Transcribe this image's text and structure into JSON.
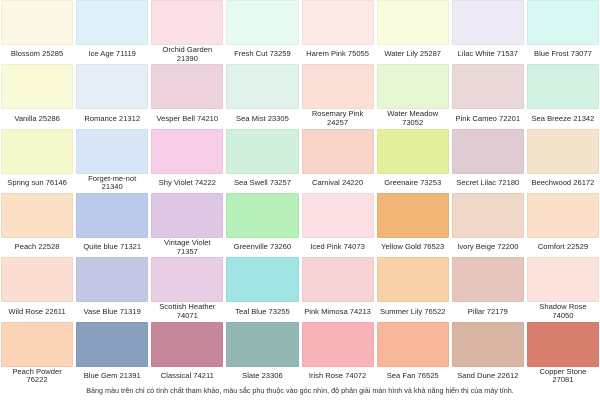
{
  "swatches": [
    {
      "name": "Blossom 25285",
      "color": "#fdf7e6"
    },
    {
      "name": "Ice Age 71119",
      "color": "#dff0f8"
    },
    {
      "name": "Orchid Garden\n21390",
      "color": "#fbe0e5"
    },
    {
      "name": "Fresh Cut 73259",
      "color": "#e8fbf0"
    },
    {
      "name": "Harem Pink 75055",
      "color": "#fde9e5"
    },
    {
      "name": "Water Lily 25287",
      "color": "#fbfbe0"
    },
    {
      "name": "Lilac White 71537",
      "color": "#eeebf7"
    },
    {
      "name": "Blue Frost 73077",
      "color": "#d8f8f4"
    },
    {
      "name": "Vanilla 25286",
      "color": "#fbfad8"
    },
    {
      "name": "Romance 21312",
      "color": "#e6eef8"
    },
    {
      "name": "Vesper Bell 74210",
      "color": "#eed3de"
    },
    {
      "name": "Sea Mist 23305",
      "color": "#e0f2ea"
    },
    {
      "name": "Rosemary Pink\n24257",
      "color": "#fbe0d8"
    },
    {
      "name": "Water Meadow\n73052",
      "color": "#e7f6d3"
    },
    {
      "name": "Pink Cameo 72201",
      "color": "#ead8d8"
    },
    {
      "name": "Sea Breeze 21342",
      "color": "#d3f2e2"
    },
    {
      "name": "Spring sun 76146",
      "color": "#f6f8ce"
    },
    {
      "name": "Forget-me-not\n21340",
      "color": "#d8e6f8"
    },
    {
      "name": "Shy Violet 74222",
      "color": "#f8cde7"
    },
    {
      "name": "Sea Swell 73257",
      "color": "#d0f0dc"
    },
    {
      "name": "Carnival 24220",
      "color": "#f8d3c8"
    },
    {
      "name": "Greenaire 73253",
      "color": "#e4ef9c"
    },
    {
      "name": "Secret Lilac 72180",
      "color": "#e0cbd3"
    },
    {
      "name": "Beechwood 26172",
      "color": "#f3e4cb"
    },
    {
      "name": "Peach 22528",
      "color": "#fbe0c6"
    },
    {
      "name": "Quite blue 71321",
      "color": "#bccbec"
    },
    {
      "name": "Vintage Violet\n71357",
      "color": "#dfc6e4"
    },
    {
      "name": "Greenville 73260",
      "color": "#b6f0b8"
    },
    {
      "name": "Iced Pink 74073",
      "color": "#fbe0e4"
    },
    {
      "name": "Yellow Gold 76523",
      "color": "#f0b577"
    },
    {
      "name": "Ivory Beige 72200",
      "color": "#f0d8c8"
    },
    {
      "name": "Comfort 22529",
      "color": "#fbdfc8"
    },
    {
      "name": "Wild Rose 22611",
      "color": "#fcded3"
    },
    {
      "name": "Vase Blue 71319",
      "color": "#c4c8e4"
    },
    {
      "name": "Scottish Heather\n74071",
      "color": "#e8cde5"
    },
    {
      "name": "Teal Blue 73255",
      "color": "#a0e4e4"
    },
    {
      "name": "Pink Mimosa 74213",
      "color": "#f8d3d6"
    },
    {
      "name": "Summer Lily 76522",
      "color": "#f9d1a6"
    },
    {
      "name": "Pillar 72179",
      "color": "#e6c6bc"
    },
    {
      "name": "Shadow Rose\n74050",
      "color": "#fbe3dc"
    },
    {
      "name": "Peach Powder\n76222",
      "color": "#fbd3b6"
    },
    {
      "name": "Blue Gem 21391",
      "color": "#8a9fbd"
    },
    {
      "name": "Classical 74211",
      "color": "#c7879a"
    },
    {
      "name": "Slate 23306",
      "color": "#93b8b3"
    },
    {
      "name": "Irish Rose 74072",
      "color": "#f7b3b8"
    },
    {
      "name": "Sea Fan 76525",
      "color": "#f8b69a"
    },
    {
      "name": "Sand Dune 22612",
      "color": "#d9b5a4"
    },
    {
      "name": "Copper Stone\n27081",
      "color": "#d87f70"
    }
  ],
  "footer_note": "Bảng màu trên chỉ có tính chất tham khảo, màu sắc phụ thuộc vào góc nhìn, độ phân giải màn hình và khả năng hiển thị của máy tính."
}
